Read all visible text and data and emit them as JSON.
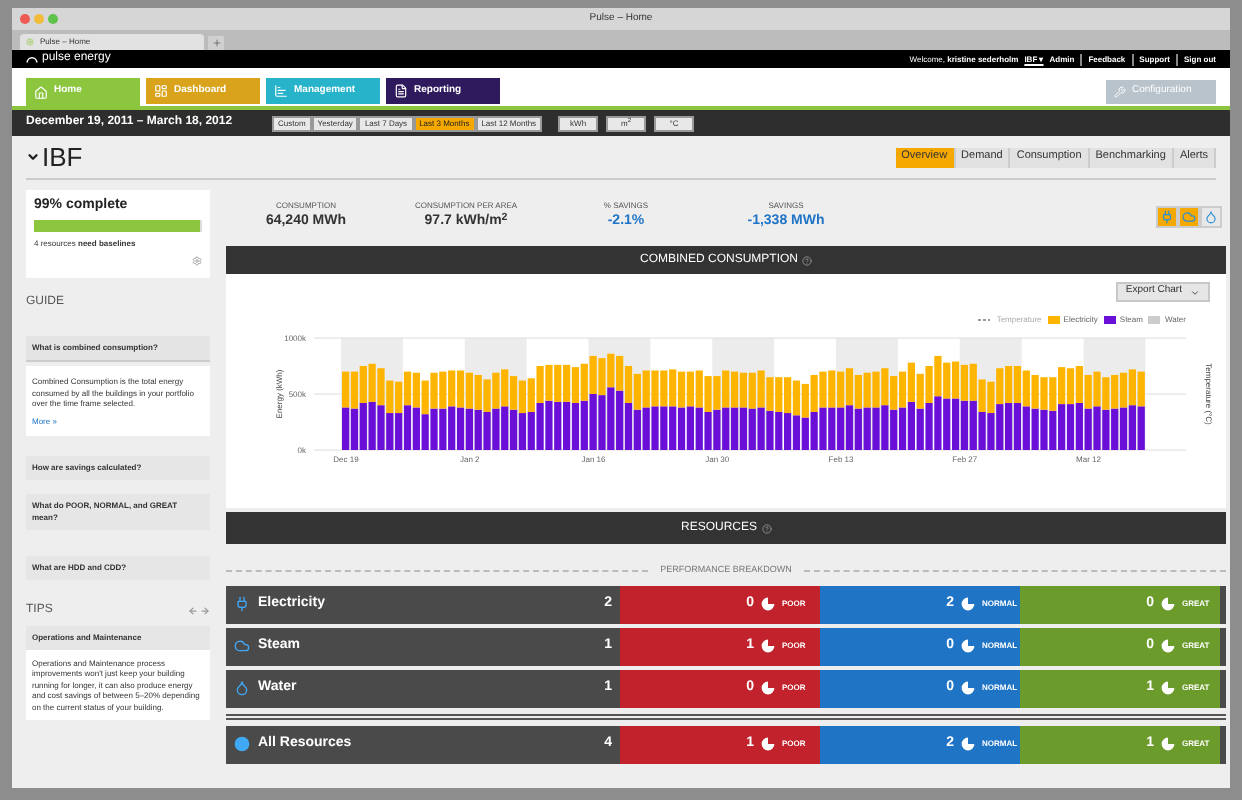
{
  "window": {
    "title": "Pulse – Home"
  },
  "browser_tab": {
    "title": "Pulse – Home"
  },
  "header": {
    "logo": "pulse energy",
    "welcome": "Welcome, **kristine sederholm**",
    "account": "IBF ▾",
    "links": [
      "Admin",
      "Feedback",
      "Support",
      "Sign out"
    ]
  },
  "nav": {
    "tabs": [
      {
        "label": "Home",
        "kind": "home",
        "color": "#8cc63f",
        "selected": true
      },
      {
        "label": "Dashboard",
        "kind": "dashboard",
        "color": "#d9a41c",
        "selected": false
      },
      {
        "label": "Management",
        "kind": "management",
        "color": "#27b3c9",
        "selected": false
      },
      {
        "label": "Reporting",
        "kind": "reporting",
        "color": "#2f1a5e",
        "selected": false
      }
    ],
    "configuration": "Configuration"
  },
  "date_bar": {
    "range": "December 19, 2011 – March 18, 2012",
    "periods": [
      {
        "label": "Custom",
        "selected": false
      },
      {
        "label": "Yesterday",
        "selected": false
      },
      {
        "label": "Last 7 Days",
        "selected": false
      },
      {
        "label": "Last 3 Months",
        "selected": true
      },
      {
        "label": "Last 12 Months",
        "selected": false
      }
    ],
    "units": [
      "kWh",
      "m$^{2}$",
      "°C"
    ]
  },
  "page": {
    "title": "IBF",
    "tabs": [
      {
        "label": "Overview",
        "selected": true
      },
      {
        "label": "Demand",
        "selected": false
      },
      {
        "label": "Consumption",
        "selected": false
      },
      {
        "label": "Benchmarking",
        "selected": false
      },
      {
        "label": "Alerts",
        "selected": false
      }
    ]
  },
  "completion": {
    "title": "99% complete",
    "level": 0.99,
    "note": "4 resources **need baselines**"
  },
  "guide": {
    "title": "GUIDE",
    "items": [
      {
        "title": "What is combined consumption?",
        "expanded": true,
        "body": "Combined Consumption is the total energy consumed by all the buildings in your portfolio over the time frame selected.",
        "more": "More »"
      },
      {
        "title": "How are savings calculated?",
        "expanded": false
      },
      {
        "title": "What do POOR, NORMAL, and GREAT mean?",
        "expanded": false
      },
      {
        "title": "What are HDD and CDD?",
        "expanded": false
      }
    ]
  },
  "tips": {
    "title": "TIPS",
    "tip_title": "Operations and Maintenance",
    "body": "Operations and Maintenance process improvements won't just keep your building running for longer, it can also produce energy and cost savings of between 5–20% depending on the current status of your building."
  },
  "stats": [
    {
      "label": "CONSUMPTION",
      "value": "64,240 MWh",
      "kind": "plain"
    },
    {
      "label": "CONSUMPTION PER AREA",
      "value": "97.7 kWh/m$^{2}$",
      "kind": "plain"
    },
    {
      "label": "% SAVINGS",
      "value": "-2.1%",
      "kind": "savings"
    },
    {
      "label": "SAVINGS",
      "value": "-1,338 MWh",
      "kind": "savings"
    }
  ],
  "resource_filters": [
    {
      "kind": "electricity",
      "selected": true
    },
    {
      "kind": "steam",
      "selected": true
    },
    {
      "kind": "water",
      "selected": false
    }
  ],
  "combined_consumption": {
    "title": "COMBINED CONSUMPTION",
    "export": "Export Chart",
    "legend_line": "Temperature",
    "right_axis_label": "Temperature (°C)",
    "chart_data": {
      "type": "bar",
      "stacked": true,
      "ylabel": "Energy (kWh)",
      "ylim": [
        0,
        1000
      ],
      "yticks": [
        {
          "value": 0,
          "label": "0k"
        },
        {
          "value": 500,
          "label": "500k"
        },
        {
          "value": 1000,
          "label": "1000k"
        }
      ],
      "categories": [
        "Dec 19",
        null,
        null,
        null,
        null,
        null,
        null,
        null,
        null,
        null,
        null,
        null,
        null,
        null,
        "Jan 2",
        null,
        null,
        null,
        null,
        null,
        null,
        null,
        null,
        null,
        null,
        null,
        null,
        null,
        "Jan 16",
        null,
        null,
        null,
        null,
        null,
        null,
        null,
        null,
        null,
        null,
        null,
        null,
        null,
        "Jan 30",
        null,
        null,
        null,
        null,
        null,
        null,
        null,
        null,
        null,
        null,
        null,
        null,
        null,
        "Feb 13",
        null,
        null,
        null,
        null,
        null,
        null,
        null,
        null,
        null,
        null,
        null,
        null,
        null,
        "Feb 27",
        null,
        null,
        null,
        null,
        null,
        null,
        null,
        null,
        null,
        null,
        null,
        null,
        null,
        "Mar 12",
        null,
        null,
        null,
        null,
        null,
        null
      ],
      "series": [
        {
          "name": "Electricity",
          "color": "#ffb400",
          "values": [
            320,
            330,
            330,
            340,
            330,
            290,
            280,
            300,
            310,
            300,
            320,
            330,
            320,
            330,
            320,
            310,
            290,
            320,
            330,
            300,
            290,
            300,
            330,
            320,
            330,
            330,
            320,
            330,
            340,
            330,
            300,
            310,
            330,
            320,
            330,
            320,
            320,
            330,
            320,
            310,
            330,
            320,
            300,
            330,
            320,
            310,
            320,
            330,
            300,
            310,
            320,
            310,
            300,
            330,
            320,
            330,
            320,
            330,
            300,
            310,
            320,
            330,
            300,
            320,
            350,
            310,
            330,
            360,
            320,
            330,
            320,
            330,
            290,
            280,
            320,
            330,
            330,
            320,
            300,
            290,
            300,
            330,
            320,
            330,
            300,
            310,
            290,
            300,
            310,
            320,
            310
          ]
        },
        {
          "name": "Steam",
          "color": "#6a0fd8",
          "values": [
            380,
            370,
            420,
            430,
            400,
            330,
            330,
            400,
            380,
            320,
            370,
            370,
            390,
            380,
            370,
            360,
            340,
            370,
            390,
            360,
            330,
            340,
            420,
            440,
            430,
            430,
            420,
            440,
            500,
            490,
            560,
            530,
            420,
            360,
            380,
            390,
            390,
            390,
            380,
            390,
            380,
            340,
            360,
            380,
            380,
            380,
            370,
            380,
            350,
            340,
            330,
            310,
            290,
            340,
            380,
            380,
            380,
            400,
            370,
            380,
            380,
            400,
            360,
            380,
            430,
            370,
            420,
            480,
            460,
            460,
            440,
            440,
            340,
            330,
            410,
            420,
            420,
            390,
            370,
            360,
            350,
            410,
            410,
            420,
            370,
            390,
            360,
            370,
            380,
            400,
            390
          ]
        },
        {
          "name": "Water",
          "color": "#cccccc",
          "values": [
            0,
            0,
            0,
            0,
            0,
            0,
            0,
            0,
            0,
            0,
            0,
            0,
            0,
            0,
            0,
            0,
            0,
            0,
            0,
            0,
            0,
            0,
            0,
            0,
            0,
            0,
            0,
            0,
            0,
            0,
            0,
            0,
            0,
            0,
            0,
            0,
            0,
            0,
            0,
            0,
            0,
            0,
            0,
            0,
            0,
            0,
            0,
            0,
            0,
            0,
            0,
            0,
            0,
            0,
            0,
            0,
            0,
            0,
            0,
            0,
            0,
            0,
            0,
            0,
            0,
            0,
            0,
            0,
            0,
            0,
            0,
            0,
            0,
            0,
            0,
            0,
            0,
            0,
            0,
            0,
            0,
            0,
            0,
            0,
            0,
            0,
            0,
            0,
            0,
            0,
            0
          ]
        }
      ]
    }
  },
  "resources": {
    "title": "RESOURCES",
    "breakdown": "PERFORMANCE BREAKDOWN",
    "rows": [
      {
        "kind": "electricity",
        "name": "Electricity",
        "count": "2",
        "cells": [
          {
            "kind": "poor",
            "count": "0",
            "label": "POOR"
          },
          {
            "kind": "normal",
            "count": "2",
            "label": "NORMAL"
          },
          {
            "kind": "great",
            "count": "0",
            "label": "GREAT"
          }
        ]
      },
      {
        "kind": "steam",
        "name": "Steam",
        "count": "1",
        "cells": [
          {
            "kind": "poor",
            "count": "1",
            "label": "POOR"
          },
          {
            "kind": "normal",
            "count": "0",
            "label": "NORMAL"
          },
          {
            "kind": "great",
            "count": "0",
            "label": "GREAT"
          }
        ]
      },
      {
        "kind": "water",
        "name": "Water",
        "count": "1",
        "cells": [
          {
            "kind": "poor",
            "count": "0",
            "label": "POOR"
          },
          {
            "kind": "normal",
            "count": "0",
            "label": "NORMAL"
          },
          {
            "kind": "great",
            "count": "1",
            "label": "GREAT"
          }
        ]
      }
    ],
    "total": {
      "kind": "all",
      "name": "All Resources",
      "count": "4",
      "cells": [
        {
          "kind": "poor",
          "count": "1",
          "label": "POOR"
        },
        {
          "kind": "normal",
          "count": "2",
          "label": "NORMAL"
        },
        {
          "kind": "great",
          "count": "1",
          "label": "GREAT"
        }
      ]
    }
  }
}
